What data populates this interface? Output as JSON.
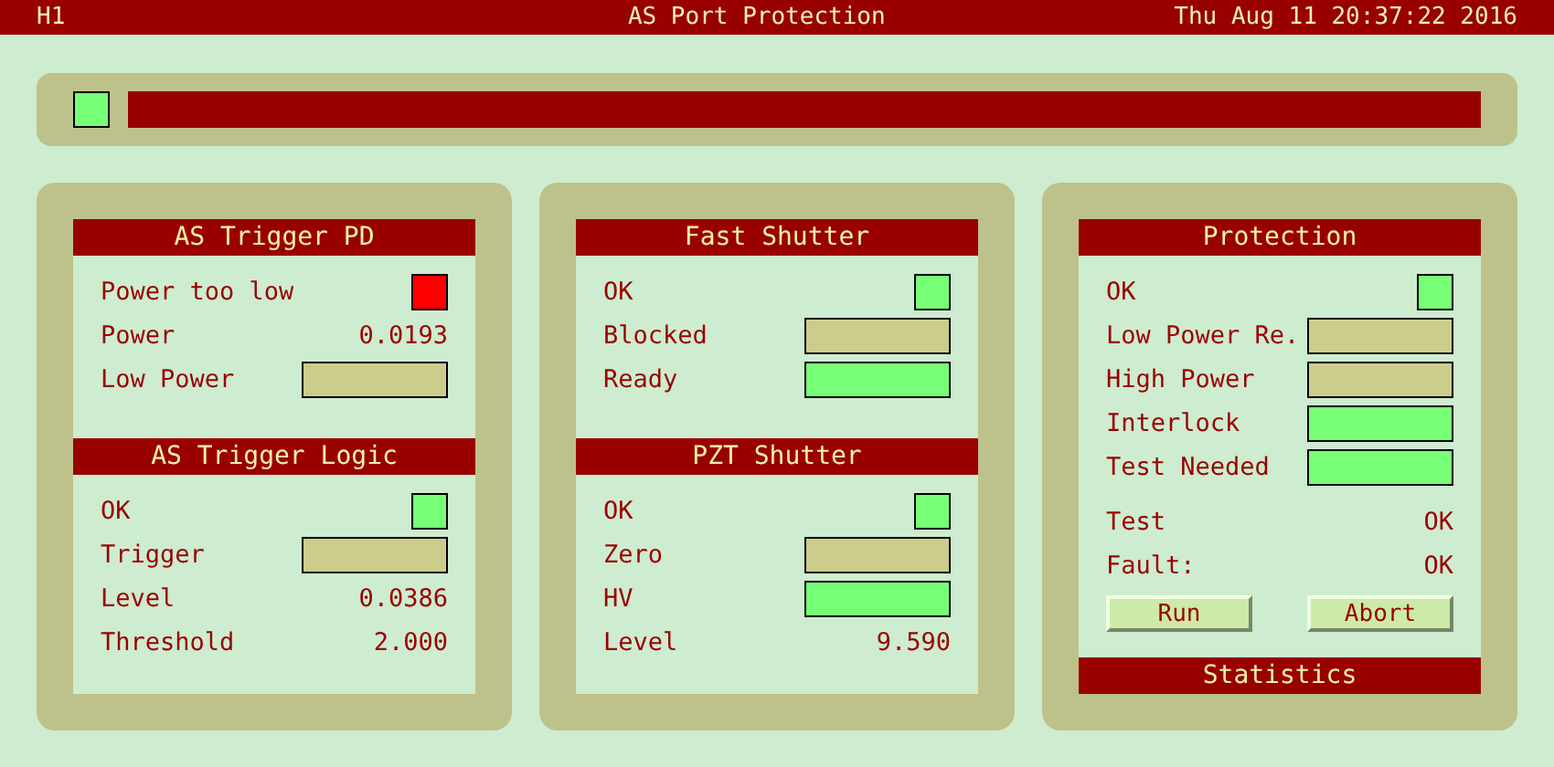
{
  "header": {
    "site": "H1",
    "title": "AS Port Protection",
    "datetime": "Thu Aug 11 20:37:22 2016"
  },
  "banner": {
    "color": "#77ff77"
  },
  "panels": [
    {
      "sections": [
        {
          "title": "AS Trigger PD",
          "rows": [
            {
              "kind": "indicator",
              "label": "Power too low",
              "color": "#ff0000"
            },
            {
              "kind": "value",
              "label": "Power",
              "value": "0.0193"
            },
            {
              "kind": "bar",
              "label": "Low Power",
              "color": "#cccc8c"
            }
          ]
        },
        {
          "title": "AS Trigger Logic",
          "rows": [
            {
              "kind": "indicator",
              "label": "OK",
              "color": "#77ff77"
            },
            {
              "kind": "bar",
              "label": "Trigger",
              "color": "#cccc8c"
            },
            {
              "kind": "value",
              "label": "Level",
              "value": "0.0386"
            },
            {
              "kind": "value",
              "label": "Threshold",
              "value": "2.000"
            }
          ]
        }
      ]
    },
    {
      "sections": [
        {
          "title": "Fast Shutter",
          "rows": [
            {
              "kind": "indicator",
              "label": "OK",
              "color": "#77ff77"
            },
            {
              "kind": "bar",
              "label": "Blocked",
              "color": "#cccc8c"
            },
            {
              "kind": "bar",
              "label": "Ready",
              "color": "#77ff77"
            }
          ]
        },
        {
          "title": "PZT Shutter",
          "rows": [
            {
              "kind": "indicator",
              "label": "OK",
              "color": "#77ff77"
            },
            {
              "kind": "bar",
              "label": "Zero",
              "color": "#cccc8c"
            },
            {
              "kind": "bar",
              "label": "HV",
              "color": "#77ff77"
            },
            {
              "kind": "value",
              "label": "Level",
              "value": "9.590"
            }
          ]
        }
      ]
    },
    {
      "sections": [
        {
          "title": "Protection",
          "rows": [
            {
              "kind": "indicator",
              "label": "OK",
              "color": "#77ff77"
            },
            {
              "kind": "bar",
              "label": "Low Power Re.",
              "color": "#cccc8c"
            },
            {
              "kind": "bar",
              "label": "High Power",
              "color": "#cccc8c"
            },
            {
              "kind": "bar",
              "label": "Interlock",
              "color": "#77ff77"
            },
            {
              "kind": "bar",
              "label": "Test Needed",
              "color": "#77ff77"
            },
            {
              "kind": "value",
              "label": "Test",
              "value": "OK"
            },
            {
              "kind": "value",
              "label": "Fault:",
              "value": "OK"
            }
          ],
          "buttons": [
            "Run",
            "Abort"
          ]
        },
        {
          "title": "Statistics"
        }
      ]
    }
  ]
}
